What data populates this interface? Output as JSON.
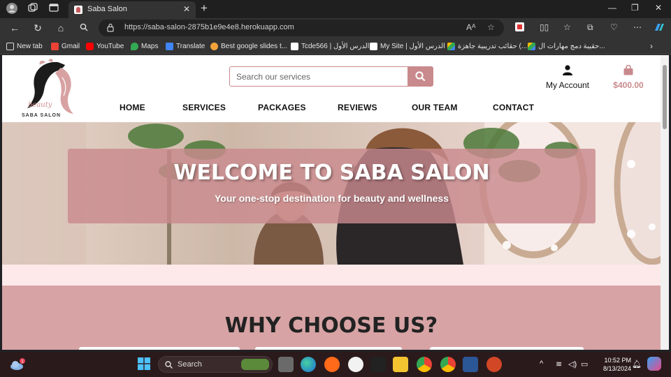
{
  "browser": {
    "tab_title": "Saba Salon",
    "url": "https://saba-salon-2875b1e9e4e8.herokuapp.com",
    "bookmarks": [
      "New tab",
      "Gmail",
      "YouTube",
      "Maps",
      "Translate",
      "Best google slides t...",
      "Tcde566 | الدرس الأول",
      "My Site | الدرس الأول",
      "حقائب تدريبية جاهزة (...",
      "حقيبة دمج مهارات ال..."
    ]
  },
  "site": {
    "brand_script": "beauty",
    "brand_name": "SABA SALON",
    "search_placeholder": "Search our services",
    "account_label": "My Account",
    "cart_total": "$400.00",
    "nav": [
      "HOME",
      "SERVICES",
      "PACKAGES",
      "REVIEWS",
      "OUR TEAM",
      "CONTACT"
    ],
    "hero_title": "WELCOME TO SABA SALON",
    "hero_subtitle": "Your one-stop destination for beauty and wellness",
    "section_title": "WHY CHOOSE US?",
    "brand_color": "#c98a8d",
    "section_bg": "#d7a3a4"
  },
  "taskbar": {
    "search_label": "Search",
    "time": "10:52 PM",
    "date": "8/13/2024",
    "weather_badge": "1"
  }
}
